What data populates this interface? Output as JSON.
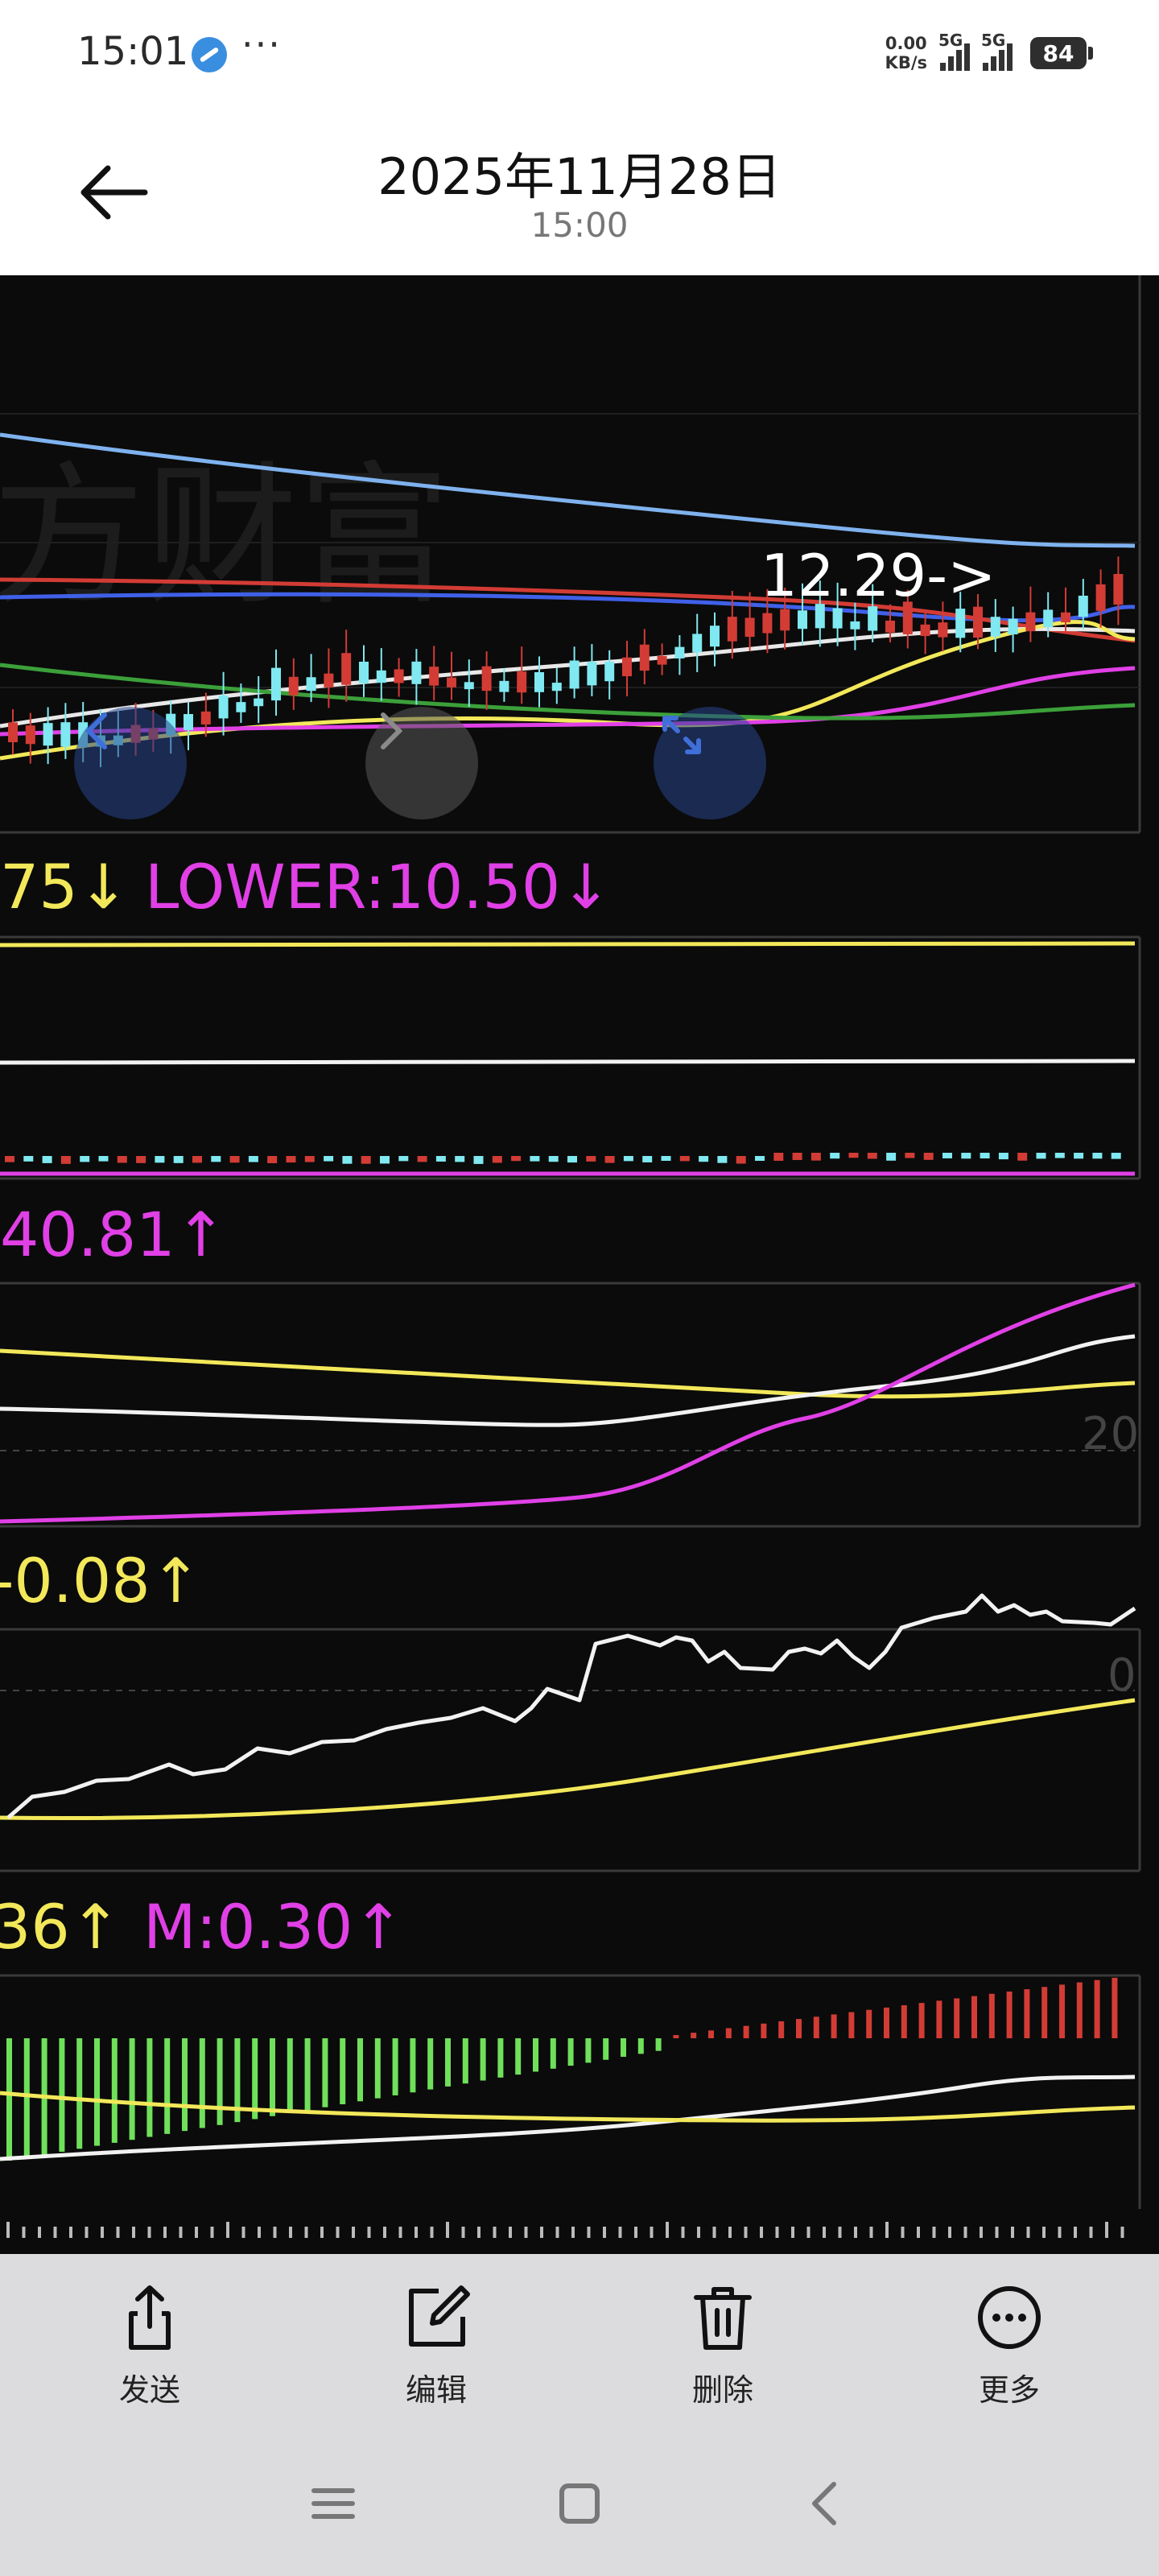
{
  "status": {
    "time": "15:01",
    "more": "···",
    "netspeed_value": "0.00",
    "netspeed_unit": "KB/s",
    "sim1": "5G",
    "sim2": "5G",
    "battery": "84"
  },
  "header": {
    "title": "2025年11月28日",
    "subtitle": "15:00"
  },
  "chart": {
    "price_annotation": "12.29->",
    "boll_label_a": "75↓",
    "boll_label_b": "LOWER:10.50↓",
    "ind2_label": "40.81↑",
    "ind2_ref": "20",
    "ind3_label": "-0.08↑",
    "ind3_ref": "0",
    "macd_label_a": "36↑",
    "macd_label_b": "M:0.30↑",
    "colors": {
      "yellow": "#f2e85a",
      "magenta": "#e040e6",
      "white": "#f2f2f2",
      "green": "#6fe05a",
      "red": "#d23c35",
      "cyan": "#7fe8f0",
      "blue": "#4060e8",
      "lightblue": "#7fb2ee"
    }
  },
  "actions": [
    {
      "label": "发送",
      "icon": "share-icon"
    },
    {
      "label": "编辑",
      "icon": "edit-icon"
    },
    {
      "label": "删除",
      "icon": "trash-icon"
    },
    {
      "label": "更多",
      "icon": "more-icon"
    }
  ]
}
